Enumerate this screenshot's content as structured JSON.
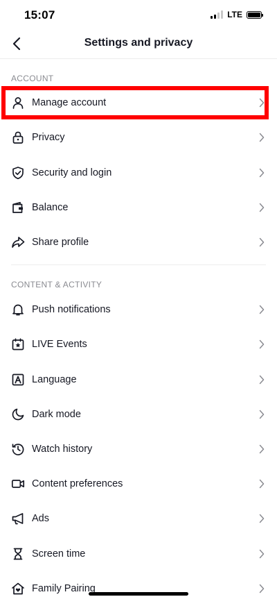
{
  "status_bar": {
    "time": "15:07",
    "network": "LTE"
  },
  "nav": {
    "title": "Settings and privacy"
  },
  "sections": [
    {
      "header": "ACCOUNT"
    },
    {
      "header": "CONTENT & ACTIVITY"
    }
  ],
  "account_items": [
    {
      "label": "Manage account",
      "icon": "person-icon"
    },
    {
      "label": "Privacy",
      "icon": "lock-icon"
    },
    {
      "label": "Security and login",
      "icon": "shield-icon"
    },
    {
      "label": "Balance",
      "icon": "wallet-icon"
    },
    {
      "label": "Share profile",
      "icon": "share-arrow-icon"
    }
  ],
  "content_items": [
    {
      "label": "Push notifications",
      "icon": "bell-icon"
    },
    {
      "label": "LIVE Events",
      "icon": "calendar-star-icon"
    },
    {
      "label": "Language",
      "icon": "language-icon"
    },
    {
      "label": "Dark mode",
      "icon": "moon-icon"
    },
    {
      "label": "Watch history",
      "icon": "history-icon"
    },
    {
      "label": "Content preferences",
      "icon": "video-camera-icon"
    },
    {
      "label": "Ads",
      "icon": "megaphone-icon"
    },
    {
      "label": "Screen time",
      "icon": "hourglass-icon"
    },
    {
      "label": "Family Pairing",
      "icon": "house-heart-icon"
    }
  ],
  "colors": {
    "text": "#161823",
    "secondary": "#8a8b91",
    "highlight": "#ff0000",
    "divider": "#ececec"
  }
}
